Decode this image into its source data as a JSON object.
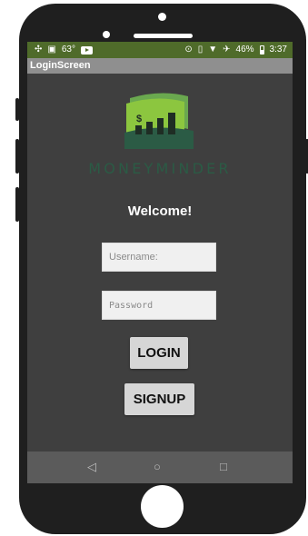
{
  "status_bar": {
    "temperature": "63°",
    "battery": "46%",
    "time": "3:37",
    "icons": [
      "fan-icon",
      "image-icon",
      "youtube-icon",
      "sync-icon",
      "vibrate-icon",
      "wifi-icon",
      "airplane-icon",
      "battery-icon"
    ]
  },
  "app_bar": {
    "title": "LoginScreen"
  },
  "logo": {
    "brand": "MONEYMINDER",
    "symbol": "$",
    "colors": {
      "light_green": "#8cc63f",
      "mid_green": "#6aa84f",
      "dark_green": "#2b5b45",
      "bars": "#1f2d24"
    }
  },
  "welcome": "Welcome!",
  "form": {
    "username_placeholder": "Username:",
    "password_placeholder": "Password"
  },
  "buttons": {
    "login": "LOGIN",
    "signup": "SIGNUP"
  },
  "nav": {
    "back": "◁",
    "home": "○",
    "recent": "□"
  },
  "colors": {
    "status_bar": "#4f6b2a",
    "app_bar": "#8f8f8f",
    "screen_bg": "#3f3f3f",
    "nav_bar": "#5b5b5b"
  }
}
